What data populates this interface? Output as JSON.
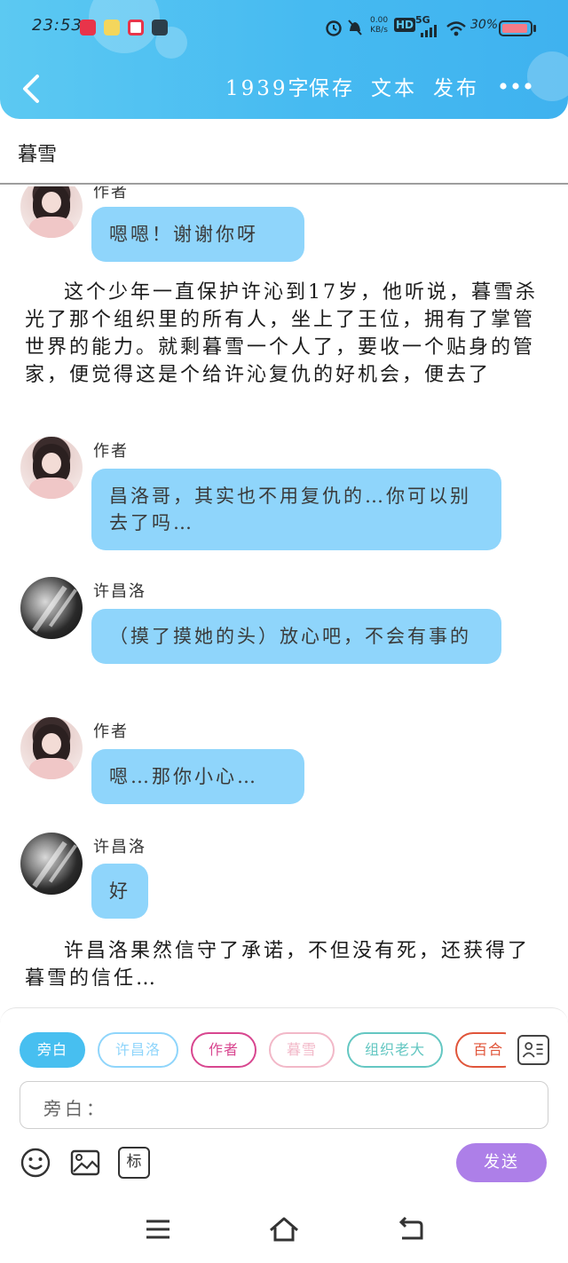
{
  "status_bar": {
    "time": "23:53",
    "net_speed_top": "0.00",
    "net_speed_bottom": "KB/s",
    "hd": "HD",
    "network": "5G",
    "battery_percent": "30%",
    "battery_level": 0.3
  },
  "toolbar": {
    "word_count": "1939字",
    "save_label": "保存",
    "text_label": "文本",
    "publish_label": "发布"
  },
  "title": "暮雪",
  "messages": [
    {
      "type": "dialog",
      "speaker": "作者",
      "avatar": "author",
      "text": "嗯嗯！谢谢你呀"
    },
    {
      "type": "narration",
      "text": "这个少年一直保护许沁到17岁，他听说，暮雪杀光了那个组织里的所有人，坐上了王位，拥有了掌管世界的能力。就剩暮雪一个人了，要收一个贴身的管家，便觉得这是个给许沁复仇的好机会，便去了"
    },
    {
      "type": "dialog",
      "speaker": "作者",
      "avatar": "author",
      "text": "昌洛哥，其实也不用复仇的…你可以别去了吗…"
    },
    {
      "type": "dialog",
      "speaker": "许昌洛",
      "avatar": "xu",
      "text": "（摸了摸她的头）放心吧，不会有事的"
    },
    {
      "type": "dialog",
      "speaker": "作者",
      "avatar": "author",
      "text": "嗯…那你小心…"
    },
    {
      "type": "dialog",
      "speaker": "许昌洛",
      "avatar": "xu",
      "text": "好"
    },
    {
      "type": "narration",
      "text": "许昌洛果然信守了承诺，不但没有死，还获得了暮雪的信任…"
    }
  ],
  "roles": [
    {
      "label": "旁白",
      "color": "#47bff0",
      "active": true
    },
    {
      "label": "许昌洛",
      "color": "#8fd5fb",
      "active": false
    },
    {
      "label": "作者",
      "color": "#d8468f",
      "active": false
    },
    {
      "label": "暮雪",
      "color": "#f2b8c8",
      "active": false
    },
    {
      "label": "组织老大",
      "color": "#64c7c2",
      "active": false
    },
    {
      "label": "百合",
      "color": "#e0553a",
      "active": false
    }
  ],
  "composer": {
    "input_label": "旁白：",
    "input_value": "",
    "send_label": "发送",
    "tag_label": "标"
  }
}
